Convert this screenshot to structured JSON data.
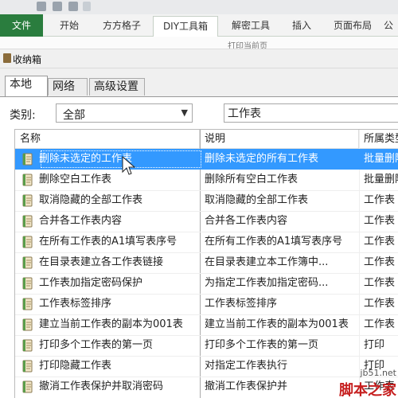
{
  "ribbon": {
    "tabs": [
      {
        "label": "文件"
      },
      {
        "label": "开始"
      },
      {
        "label": "方方格子"
      },
      {
        "label": "DIY工具箱"
      },
      {
        "label": "解密工具"
      },
      {
        "label": "插入"
      },
      {
        "label": "页面布局"
      }
    ],
    "strip_partial": "打印当前页"
  },
  "dialog": {
    "title": "收纳箱",
    "tabs": [
      {
        "label": "本地"
      },
      {
        "label": "网络"
      },
      {
        "label": "高级设置"
      }
    ],
    "category_label": "类别:",
    "category_value": "全部",
    "search_value": "工作表"
  },
  "list": {
    "columns": [
      "名称",
      "说明",
      "所属类型"
    ],
    "rows": [
      {
        "name": "删除未选定的工作表",
        "desc": "删除未选定的所有工作表",
        "type": "批量删除"
      },
      {
        "name": "删除空白工作表",
        "desc": "删除所有空白工作表",
        "type": "批量删除"
      },
      {
        "name": "取消隐藏的全部工作表",
        "desc": "取消隐藏的全部工作表",
        "type": "工作表"
      },
      {
        "name": "合并各工作表内容",
        "desc": "合并各工作表内容",
        "type": "工作表"
      },
      {
        "name": "在所有工作表的A1填写表序号",
        "desc": "在所有工作表的A1填写表序号",
        "type": "工作表"
      },
      {
        "name": "在目录表建立各工作表链接",
        "desc": "在目录表建立本工作簿中...",
        "type": "工作表"
      },
      {
        "name": "工作表加指定密码保护",
        "desc": "为指定工作表加指定密码...",
        "type": "工作表"
      },
      {
        "name": "工作表标签排序",
        "desc": "工作表标签排序",
        "type": "工作表"
      },
      {
        "name": "建立当前工作表的副本为001表",
        "desc": "建立当前工作表的副本为001表",
        "type": "工作表"
      },
      {
        "name": "打印多个工作表的第一页",
        "desc": "打印多个工作表的第一页",
        "type": "打印"
      },
      {
        "name": "打印隐藏工作表",
        "desc": "对指定工作表执行",
        "type": "打印"
      },
      {
        "name": "撤消工作表保护并取消密码",
        "desc": "撤消工作表保护并",
        "type": "工作表"
      }
    ]
  },
  "watermark": {
    "url": "jb51.net",
    "name": "脚本之家"
  },
  "colors": {
    "file_tab": "#2a7d3e",
    "selection": "#3399ff",
    "watermark": "#c61f1f"
  }
}
